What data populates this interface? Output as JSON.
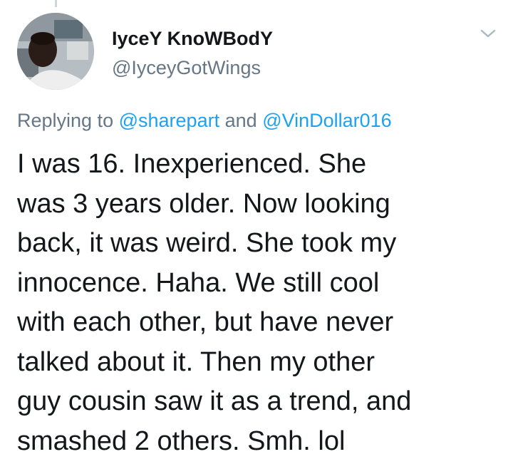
{
  "tweet": {
    "author": {
      "display_name": "IyceY KnoWBodY",
      "handle": "@IyceyGotWings"
    },
    "reply_context": {
      "prefix": "Replying to",
      "mention_1": "@sharepart",
      "connector": "and",
      "mention_2": "@VinDollar016"
    },
    "text": "I was 16. Inexperienced. She\nwas 3 years older. Now looking\nback, it was weird. She took my\ninnocence. Haha. We still cool\nwith each other, but have never\ntalked about it. Then my other\nguy cousin saw it as a trend, and\nsmashed 2 others. Smh. lol"
  },
  "icons": {
    "menu": "chevron-down-icon"
  },
  "colors": {
    "primary_text": "#14171a",
    "secondary_text": "#657786",
    "link": "#1da1f2",
    "thread_line": "#ccd6dd",
    "chevron": "#aab8c2"
  }
}
